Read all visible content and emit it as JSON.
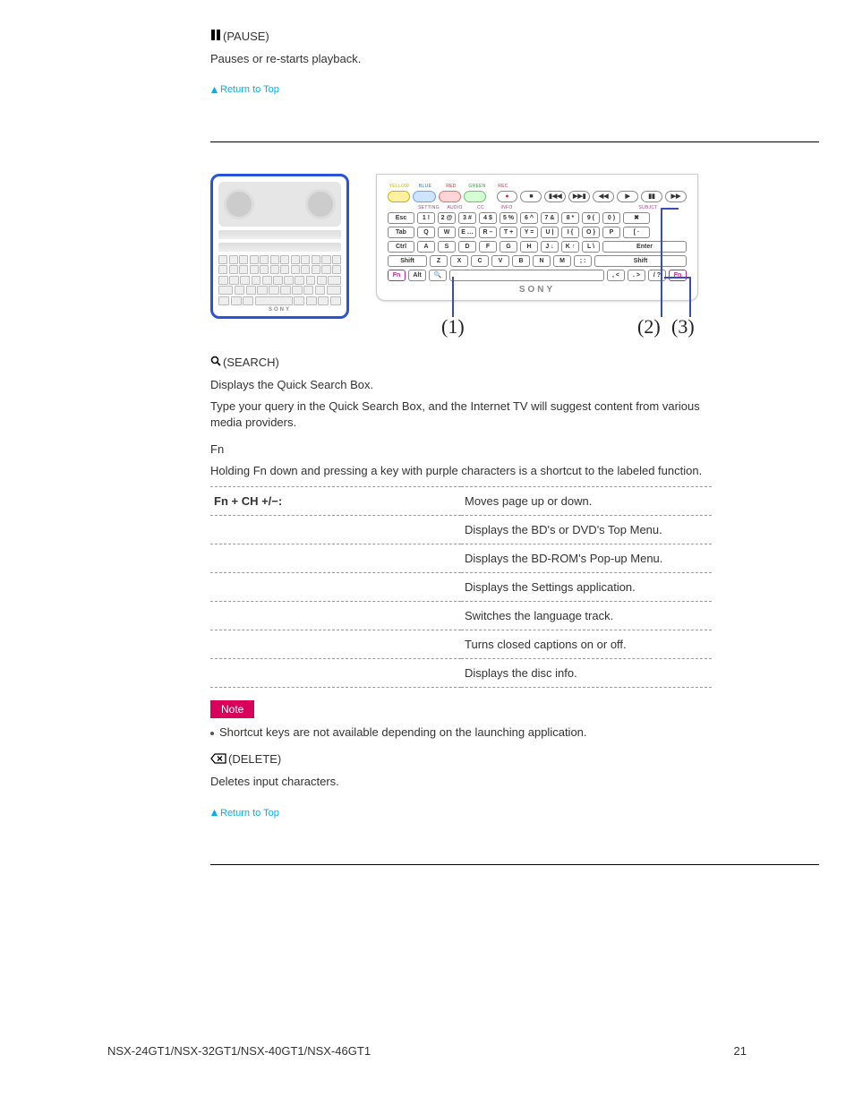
{
  "pause": {
    "title": "(PAUSE)",
    "desc": "Pauses or re-starts playback."
  },
  "return_link": "Return to Top",
  "callouts": {
    "c1": "(1)",
    "c2": "(2)",
    "c3": "(3)"
  },
  "keyboard": {
    "labels_row1": [
      "YELLOW",
      "BLUE",
      "RED",
      "GREEN",
      "REC"
    ],
    "media_pills": [
      "●",
      "■",
      "▮◀◀",
      "▶▶▮",
      "◀◀",
      "▶",
      "▮▮",
      "▶▶"
    ],
    "labels_row2_left": [
      "",
      "SETTING",
      "AUDIO",
      "CC",
      "INFO"
    ],
    "labels_row2_right": "SUBJCT",
    "row2": [
      "Esc",
      "1 !",
      "2 @",
      "3 #",
      "4 $",
      "5 %",
      "6 ^",
      "7 &",
      "8 *",
      "9 (",
      "0 )",
      "✖"
    ],
    "row3": [
      "Tab",
      "Q",
      "W",
      "E …",
      "R –",
      "T +",
      "Y =",
      "U |",
      "I {",
      "O }",
      "P",
      "[ ·"
    ],
    "row4": [
      "Ctrl",
      "A",
      "S",
      "D",
      "F",
      "G",
      "H",
      "J ↓",
      "K ↑",
      "L \\",
      "Enter"
    ],
    "row5": [
      "Shift",
      "Z",
      "X",
      "C",
      "V",
      "B",
      "N",
      "M",
      ";  :",
      "Shift"
    ],
    "row6": [
      "Fn",
      "Alt",
      "🔍",
      "",
      ", <",
      ". >",
      "/ ?",
      "Fn"
    ],
    "brand": "SONY"
  },
  "search": {
    "title": "(SEARCH)",
    "p1": "Displays the Quick Search Box.",
    "p2": "Type your query in the Quick Search Box, and the Internet TV will suggest content from various media providers."
  },
  "fn": {
    "title": "Fn",
    "desc": "Holding Fn down and pressing a key with purple characters is a shortcut to the labeled function."
  },
  "table": {
    "rows": [
      {
        "k": "Fn + CH +/−:",
        "v": "Moves page up or down."
      },
      {
        "k": "",
        "v": "Displays the BD's or DVD's Top Menu."
      },
      {
        "k": "",
        "v": "Displays the BD-ROM's Pop-up Menu."
      },
      {
        "k": "",
        "v": "Displays the Settings application."
      },
      {
        "k": "",
        "v": "Switches the language track."
      },
      {
        "k": "",
        "v": "Turns closed captions on or off."
      },
      {
        "k": "",
        "v": "Displays the disc info."
      }
    ]
  },
  "note": {
    "label": "Note",
    "text": "Shortcut keys are not available depending on the launching application."
  },
  "delete": {
    "title": "(DELETE)",
    "desc": "Deletes input characters."
  },
  "footer": {
    "model": "NSX-24GT1/NSX-32GT1/NSX-40GT1/NSX-46GT1",
    "page": "21"
  }
}
